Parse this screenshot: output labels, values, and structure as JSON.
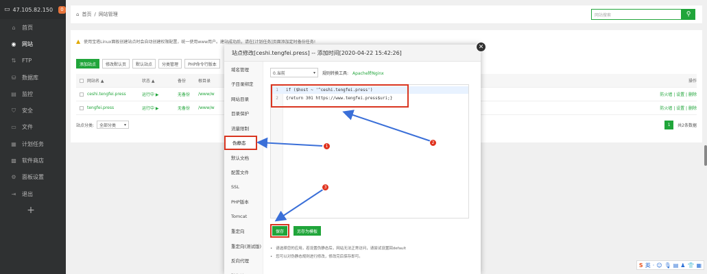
{
  "sidebar": {
    "ip": "47.105.82.150",
    "badge": "0",
    "items": [
      {
        "label": "首页",
        "icon": "home-icon",
        "glyph": "⌂"
      },
      {
        "label": "网站",
        "icon": "globe-icon",
        "glyph": "◉"
      },
      {
        "label": "FTP",
        "icon": "ftp-icon",
        "glyph": "⇅"
      },
      {
        "label": "数据库",
        "icon": "database-icon",
        "glyph": "⛁"
      },
      {
        "label": "监控",
        "icon": "monitor-icon",
        "glyph": "▤"
      },
      {
        "label": "安全",
        "icon": "shield-icon",
        "glyph": "⛉"
      },
      {
        "label": "文件",
        "icon": "folder-icon",
        "glyph": "▭"
      },
      {
        "label": "计划任务",
        "icon": "calendar-icon",
        "glyph": "▦"
      },
      {
        "label": "软件商店",
        "icon": "store-icon",
        "glyph": "▩"
      },
      {
        "label": "面板设置",
        "icon": "gear-icon",
        "glyph": "⚙"
      },
      {
        "label": "退出",
        "icon": "logout-icon",
        "glyph": "⇥"
      }
    ],
    "add_glyph": "+"
  },
  "header": {
    "breadcrumb_home": "首页",
    "breadcrumb_sep": "/",
    "breadcrumb_current": "网站管理",
    "search_placeholder": "网站搜索"
  },
  "notice": {
    "text": "使用宝塔Linux面板创建站点时会自动创建权限配置，统一使用www用户。建站成功后，请在[计划任务]页面添加定时备份任务!"
  },
  "toolbar": {
    "add_site": "添加站点",
    "default_page": "修改默认页",
    "default_site": "默认站点",
    "category": "分类管理",
    "php_cli": "PHP命令行版本"
  },
  "table": {
    "headers": {
      "name": "网站名 ▲",
      "status": "状态 ▲",
      "backup": "备份",
      "root": "根目录",
      "ops": "操作"
    },
    "rows": [
      {
        "name": "ceshi.tengfei.press",
        "status": "运行中 ▶",
        "backup": "无备份",
        "root": "/www/w",
        "ops": "防火墙 | 设置 | 删除"
      },
      {
        "name": "tengfei.press",
        "status": "运行中 ▶",
        "backup": "无备份",
        "root": "/www/w",
        "ops": "防火墙 | 设置 | 删除"
      }
    ],
    "category_label": "站点分类:",
    "category_value": "全部分类",
    "page_current": "1",
    "page_total": "共2条数据"
  },
  "modal": {
    "title": "站点修改[ceshi.tengfei.press] -- 添加时间[2020-04-22 15:42:26]",
    "close_glyph": "✕",
    "tabs": [
      "域名管理",
      "子目录绑定",
      "网站目录",
      "目录保护",
      "流量限制",
      "伪静态",
      "默认文档",
      "配置文件",
      "SSL",
      "PHP版本",
      "Tomcat",
      "重定向",
      "重定向(测试版)",
      "反向代理",
      "防盗链"
    ],
    "active_tab": "伪静态",
    "rewrite_select": "0.当前",
    "tool_label": "规则转换工具:",
    "tool_link": "Apache转Nginx",
    "code": [
      {
        "ln": "1",
        "text": "if ($host ~ '^ceshi.tengfei.press')"
      },
      {
        "ln": "2",
        "text": "{return 301 https://www.tengfei.press$uri;}"
      }
    ],
    "save": "保存",
    "save_template": "另存为模板",
    "tips": [
      "请选择您的应用，若设置伪静态后，网站无法正常访问，请尝试设置回default",
      "您可以对伪静态规则进行修改，修改完后保存即可。"
    ]
  },
  "annotations": [
    "1",
    "2",
    "3"
  ],
  "tray": [
    "英",
    "·",
    "☺",
    "🎙",
    "▤",
    "♟",
    "👕",
    "▦"
  ],
  "colors": {
    "accent": "#20a53a",
    "annotation": "#e0311c",
    "sidebar": "#2f3132"
  }
}
